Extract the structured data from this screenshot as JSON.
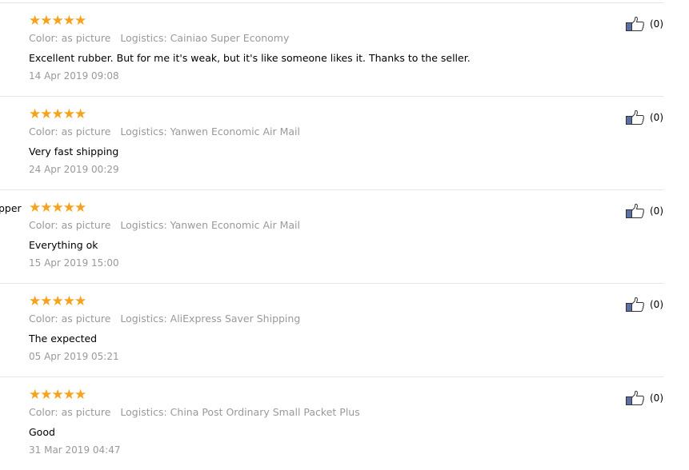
{
  "reviews": [
    {
      "user": "",
      "rating": 5,
      "color": "Color: as picture",
      "logistics": "Logistics: Cainiao Super Economy",
      "comment": "Excellent rubber. But for me it's weak, but it's like someone likes it. Thanks to the seller.",
      "date": "14 Apr 2019 09:08",
      "likes": "(0)"
    },
    {
      "user": "",
      "rating": 5,
      "color": "Color: as picture",
      "logistics": "Logistics: Yanwen Economic Air Mail",
      "comment": "Very fast shipping",
      "date": "24 Apr 2019 00:29",
      "likes": "(0)"
    },
    {
      "user": "pper",
      "rating": 5,
      "color": "Color: as picture",
      "logistics": "Logistics: Yanwen Economic Air Mail",
      "comment": "Everything ok",
      "date": "15 Apr 2019 15:00",
      "likes": "(0)"
    },
    {
      "user": "",
      "rating": 5,
      "color": "Color: as picture",
      "logistics": "Logistics: AliExpress Saver Shipping",
      "comment": "The expected",
      "date": "05 Apr 2019 05:21",
      "likes": "(0)"
    },
    {
      "user": "",
      "rating": 5,
      "color": "Color: as picture",
      "logistics": "Logistics: China Post Ordinary Small Packet Plus",
      "comment": "Good",
      "date": "31 Mar 2019 04:47",
      "likes": "(0)"
    }
  ],
  "colors": {
    "star": "#f7a21b",
    "muted": "#999999",
    "thumb": "#5b6fa6"
  },
  "icons": {
    "like": "thumbs-up-icon",
    "star": "star-icon"
  }
}
